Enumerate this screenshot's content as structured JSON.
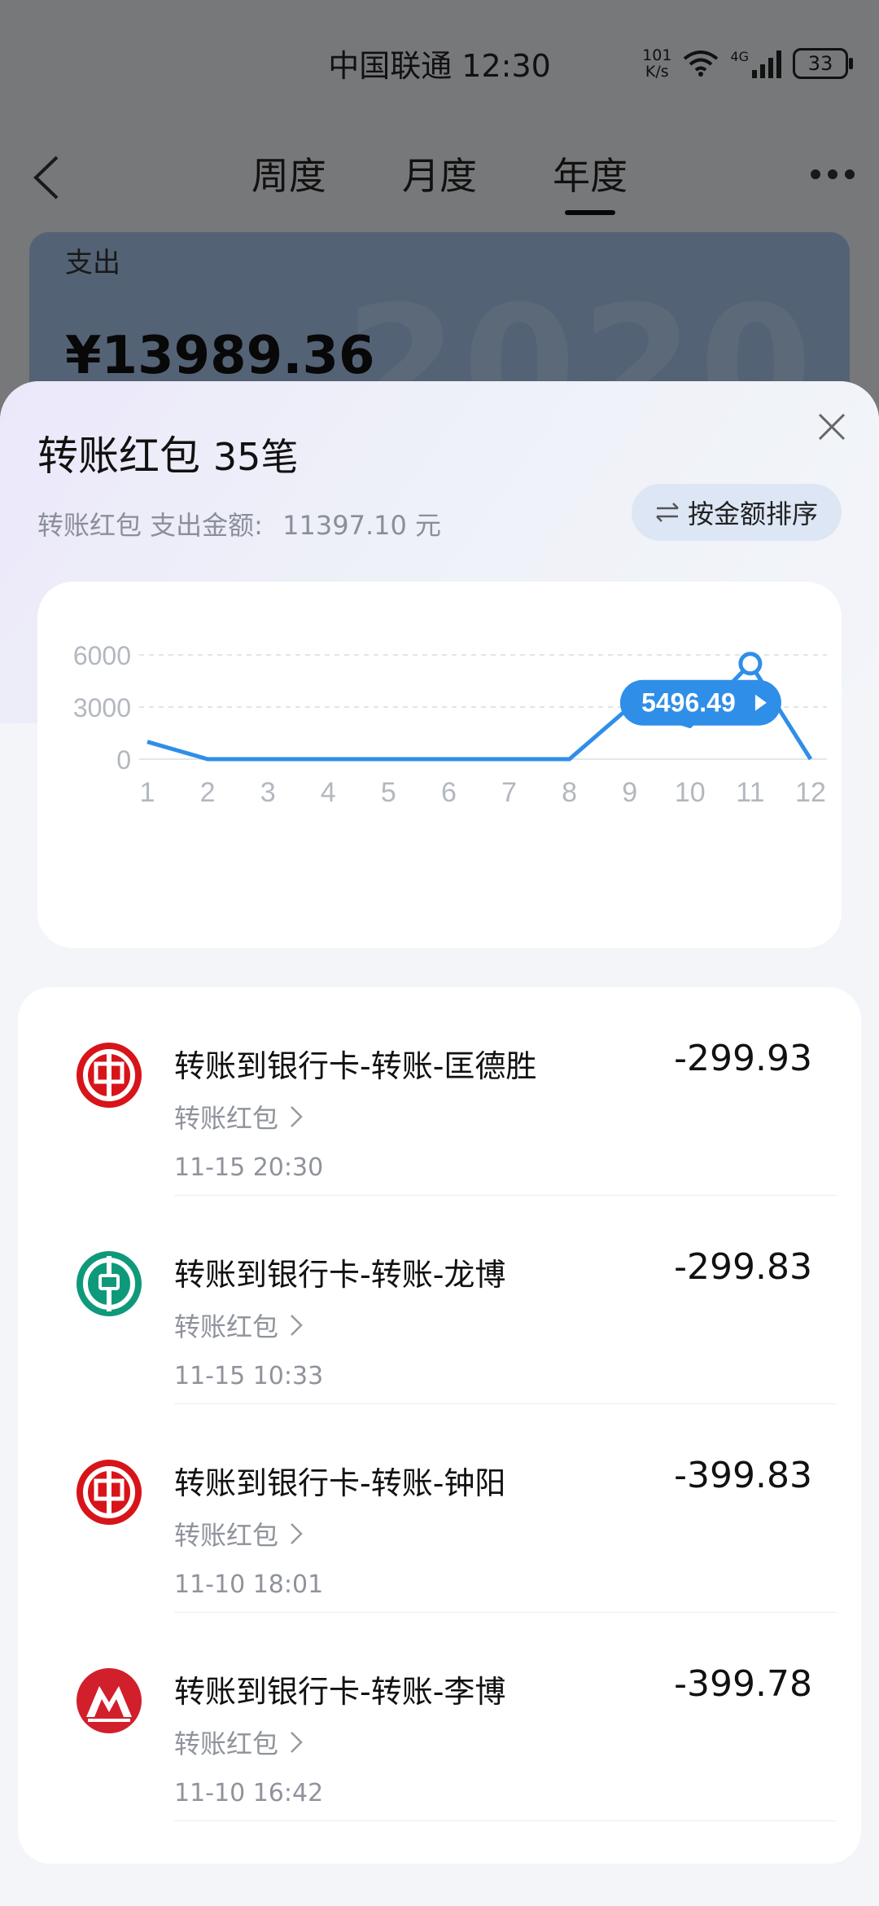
{
  "status": {
    "carrier_time": "中国联通 12:30",
    "speed_value": "101",
    "speed_unit": "K/s",
    "network": "4G",
    "battery": "33"
  },
  "nav": {
    "tabs": [
      "周度",
      "月度",
      "年度"
    ],
    "active_tab": "年度"
  },
  "summary": {
    "label": "支出",
    "amount": "¥13989.36",
    "year": "2020"
  },
  "sheet": {
    "title": "转账红包",
    "count": "35笔",
    "subtitle_label": "转账红包 支出金额:",
    "subtitle_value": "11397.10 元",
    "sort_label": "按金额排序"
  },
  "chart_data": {
    "type": "line",
    "x": [
      "1",
      "2",
      "3",
      "4",
      "5",
      "6",
      "7",
      "8",
      "9",
      "10",
      "11",
      "12"
    ],
    "values": [
      1000,
      0,
      0,
      0,
      0,
      0,
      0,
      0,
      3000,
      1900,
      5496.49,
      0
    ],
    "yticks": [
      "6000",
      "3000",
      "0"
    ],
    "ylim": [
      0,
      6000
    ],
    "grid": true,
    "highlight": {
      "index": 10,
      "label": "5496.49"
    },
    "color": "#2f8ee8"
  },
  "transactions": [
    {
      "title": "转账到银行卡-转账-匡德胜",
      "category": "转账红包",
      "time": "11-15 20:30",
      "amount": "-299.93",
      "bank_icon": "abc-bank-logo"
    },
    {
      "title": "转账到银行卡-转账-龙博",
      "category": "转账红包",
      "time": "11-15 10:33",
      "amount": "-299.83",
      "bank_icon": "abc-bank-green-logo"
    },
    {
      "title": "转账到银行卡-转账-钟阳",
      "category": "转账红包",
      "time": "11-10 18:01",
      "amount": "-399.83",
      "bank_icon": "icbc-bank-logo"
    },
    {
      "title": "转账到银行卡-转账-李博",
      "category": "转账红包",
      "time": "11-10 16:42",
      "amount": "-399.78",
      "bank_icon": "cmb-bank-logo"
    }
  ]
}
